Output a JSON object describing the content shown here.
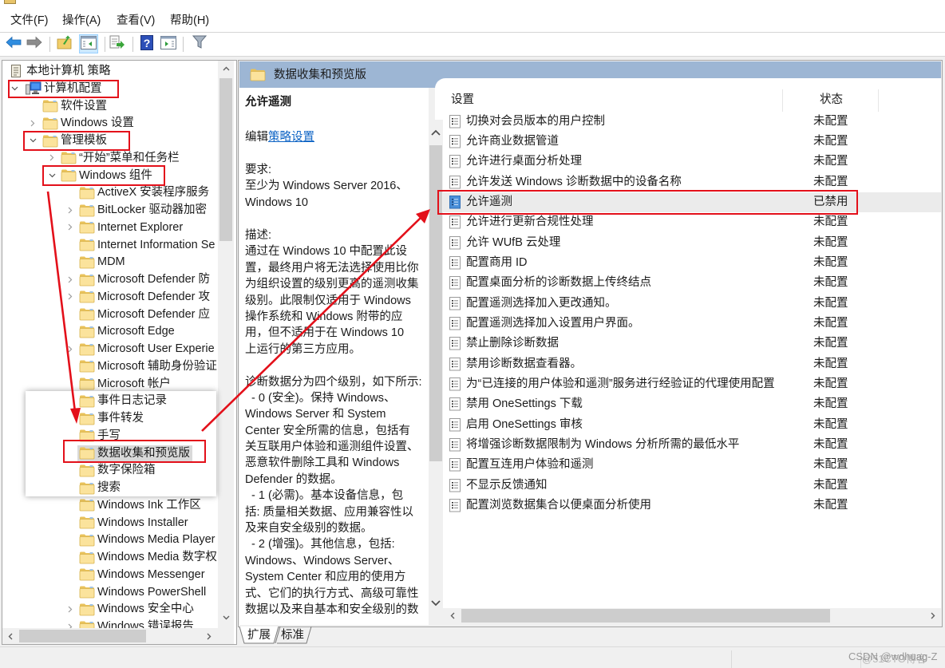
{
  "window": {
    "icon": "policy-editor-icon"
  },
  "menu": [
    {
      "label": "文件(F)"
    },
    {
      "label": "操作(A)"
    },
    {
      "label": "查看(V)"
    },
    {
      "label": "帮助(H)"
    }
  ],
  "toolbar": [
    {
      "name": "back-button",
      "icon": "back-arrow-icon"
    },
    {
      "name": "forward-button",
      "icon": "forward-arrow-icon"
    },
    {
      "name": "up-one-level-button",
      "icon": "up-folder-icon"
    },
    {
      "name": "show-hide-console-tree-button",
      "icon": "console-tree-icon",
      "active": true
    },
    {
      "name": "export-list-button",
      "icon": "export-list-icon"
    },
    {
      "name": "help-button",
      "icon": "help-icon"
    },
    {
      "name": "show-hide-action-pane-button",
      "icon": "action-pane-icon"
    },
    {
      "name": "filter-button",
      "icon": "filter-icon"
    }
  ],
  "tree": {
    "items": [
      {
        "label": "本地计算机 策略",
        "level": 0,
        "expander": "none",
        "icon": "policy-scroll-icon"
      },
      {
        "label": "计算机配置",
        "level": 1,
        "expander": "expanded",
        "icon": "computer-icon"
      },
      {
        "label": "软件设置",
        "level": 2,
        "expander": "none",
        "icon": "folder-icon"
      },
      {
        "label": "Windows 设置",
        "level": 2,
        "expander": "collapsed",
        "icon": "folder-icon"
      },
      {
        "label": "管理模板",
        "level": 2,
        "expander": "expanded",
        "icon": "folder-icon"
      },
      {
        "label": "“开始”菜单和任务栏",
        "level": 3,
        "expander": "collapsed",
        "icon": "folder-icon"
      },
      {
        "label": "Windows 组件",
        "level": 3,
        "expander": "expanded",
        "icon": "folder-icon"
      },
      {
        "label": "ActiveX 安装程序服务",
        "level": 4,
        "expander": "none",
        "icon": "folder-icon"
      },
      {
        "label": "BitLocker 驱动器加密",
        "level": 4,
        "expander": "collapsed",
        "icon": "folder-icon"
      },
      {
        "label": "Internet Explorer",
        "level": 4,
        "expander": "collapsed",
        "icon": "folder-icon"
      },
      {
        "label": "Internet Information Se",
        "level": 4,
        "expander": "none",
        "icon": "folder-icon"
      },
      {
        "label": "MDM",
        "level": 4,
        "expander": "none",
        "icon": "folder-icon"
      },
      {
        "label": "Microsoft Defender 防",
        "level": 4,
        "expander": "collapsed",
        "icon": "folder-icon"
      },
      {
        "label": "Microsoft Defender 攻",
        "level": 4,
        "expander": "collapsed",
        "icon": "folder-icon"
      },
      {
        "label": "Microsoft Defender 应",
        "level": 4,
        "expander": "none",
        "icon": "folder-icon"
      },
      {
        "label": "Microsoft Edge",
        "level": 4,
        "expander": "none",
        "icon": "folder-icon"
      },
      {
        "label": "Microsoft User Experie",
        "level": 4,
        "expander": "collapsed",
        "icon": "folder-icon"
      },
      {
        "label": "Microsoft 辅助身份验证",
        "level": 4,
        "expander": "none",
        "icon": "folder-icon"
      },
      {
        "label": "Microsoft 帐户",
        "level": 4,
        "expander": "none",
        "icon": "folder-icon"
      },
      {
        "label": "事件日志记录",
        "level": 4,
        "expander": "none",
        "icon": "folder-icon",
        "in_callout": true
      },
      {
        "label": "事件转发",
        "level": 4,
        "expander": "none",
        "icon": "folder-icon",
        "in_callout": true
      },
      {
        "label": "手写",
        "level": 4,
        "expander": "none",
        "icon": "folder-icon",
        "in_callout": true
      },
      {
        "label": "数据收集和预览版",
        "level": 4,
        "expander": "none",
        "icon": "folder-icon",
        "in_callout": true,
        "selected": true
      },
      {
        "label": "数字保险箱",
        "level": 4,
        "expander": "none",
        "icon": "folder-icon",
        "in_callout": true
      },
      {
        "label": "搜索",
        "level": 4,
        "expander": "none",
        "icon": "folder-icon",
        "in_callout": true
      },
      {
        "label": "Windows Ink 工作区",
        "level": 4,
        "expander": "none",
        "icon": "folder-icon"
      },
      {
        "label": "Windows Installer",
        "level": 4,
        "expander": "none",
        "icon": "folder-icon"
      },
      {
        "label": "Windows Media Player",
        "level": 4,
        "expander": "none",
        "icon": "folder-icon"
      },
      {
        "label": "Windows Media 数字权",
        "level": 4,
        "expander": "none",
        "icon": "folder-icon"
      },
      {
        "label": "Windows Messenger",
        "level": 4,
        "expander": "none",
        "icon": "folder-icon"
      },
      {
        "label": "Windows PowerShell",
        "level": 4,
        "expander": "none",
        "icon": "folder-icon"
      },
      {
        "label": "Windows 安全中心",
        "level": 4,
        "expander": "collapsed",
        "icon": "folder-icon"
      },
      {
        "label": "Windows 错误报告",
        "level": 4,
        "expander": "collapsed",
        "icon": "folder-icon"
      }
    ]
  },
  "details": {
    "header": "数据收集和预览版",
    "title": "允许遥测",
    "edit_prefix": "编辑",
    "edit_link": "策略设置",
    "requirements_lines": [
      "要求:",
      "至少为 Windows Server 2016、",
      "Windows 10"
    ],
    "description_lines": [
      "描述:",
      "通过在 Windows 10 中配置此设",
      "置，最终用户将无法选择使用比你",
      "为组织设置的级别更高的遥测收集",
      "级别。此限制仅适用于 Windows",
      "操作系统和 Windows 附带的应",
      "用，但不适用于在 Windows 10",
      "上运行的第三方应用。",
      "",
      "诊断数据分为四个级别，如下所示:",
      "  - 0 (安全)。保持 Windows、",
      "Windows Server 和 System",
      "Center 安全所需的信息，包括有",
      "关互联用户体验和遥测组件设置、",
      "恶意软件删除工具和 Windows",
      "Defender 的数据。",
      "  - 1 (必需)。基本设备信息，包",
      "括: 质量相关数据、应用兼容性以",
      "及来自安全级别的数据。",
      "  - 2 (增强)。其他信息，包括:",
      "Windows、Windows Server、",
      "System Center 和应用的使用方",
      "式、它们的执行方式、高级可靠性",
      "数据以及来自基本和安全级别的数"
    ]
  },
  "settings_list": {
    "columns": {
      "setting": "设置",
      "state": "状态"
    },
    "rows": [
      {
        "label": "切换对会员版本的用户控制",
        "state": "未配置"
      },
      {
        "label": "允许商业数据管道",
        "state": "未配置"
      },
      {
        "label": "允许进行桌面分析处理",
        "state": "未配置"
      },
      {
        "label": "允许发送 Windows 诊断数据中的设备名称",
        "state": "未配置"
      },
      {
        "label": "允许遥测",
        "state": "已禁用",
        "selected": true
      },
      {
        "label": "允许进行更新合规性处理",
        "state": "未配置"
      },
      {
        "label": "允许 WUfB 云处理",
        "state": "未配置"
      },
      {
        "label": "配置商用 ID",
        "state": "未配置"
      },
      {
        "label": "配置桌面分析的诊断数据上传终结点",
        "state": "未配置"
      },
      {
        "label": "配置遥测选择加入更改通知。",
        "state": "未配置"
      },
      {
        "label": "配置遥测选择加入设置用户界面。",
        "state": "未配置"
      },
      {
        "label": "禁止删除诊断数据",
        "state": "未配置"
      },
      {
        "label": "禁用诊断数据查看器。",
        "state": "未配置"
      },
      {
        "label": "为“已连接的用户体验和遥测”服务进行经验证的代理使用配置",
        "state": "未配置"
      },
      {
        "label": "禁用 OneSettings 下载",
        "state": "未配置"
      },
      {
        "label": "启用 OneSettings 审核",
        "state": "未配置"
      },
      {
        "label": "将增强诊断数据限制为 Windows 分析所需的最低水平",
        "state": "未配置"
      },
      {
        "label": "配置互连用户体验和遥测",
        "state": "未配置"
      },
      {
        "label": "不显示反馈通知",
        "state": "未配置"
      },
      {
        "label": "配置浏览数据集合以便桌面分析使用",
        "state": "未配置"
      }
    ]
  },
  "view_tabs": [
    {
      "label": "扩展",
      "active": true
    },
    {
      "label": "标准"
    }
  ],
  "watermark": {
    "primary": "CSDN @wdhuag-Z",
    "secondary": "@51CTO博客"
  },
  "colors": {
    "annotation": "#e3101a",
    "header_band": "#9db6d4",
    "link": "#0b62c4",
    "selected_row": "#ebebeb",
    "selected_tree_item": "#d9d9d9"
  }
}
